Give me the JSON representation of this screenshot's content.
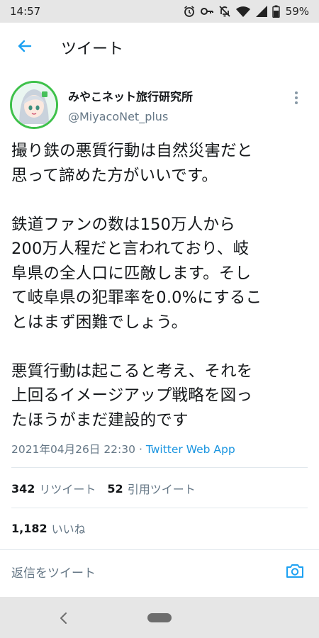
{
  "status_bar": {
    "time": "14:57",
    "battery": "59%",
    "icons": [
      "alarm-icon",
      "key-icon",
      "mute-icon",
      "wifi-icon",
      "signal-icon",
      "battery-icon"
    ]
  },
  "header": {
    "title": "ツイート",
    "back_icon": "arrow-left-icon"
  },
  "author": {
    "display_name": "みやこネット旅行研究所",
    "handle": "@MiyacoNet_plus"
  },
  "tweet": {
    "lines": [
      "撮り鉄の悪質行動は自然災害だと",
      "思って諦めた方がいいです。",
      "",
      "鉄道ファンの数は150万人から",
      "200万人程だと言われており、岐",
      "阜県の全人口に匹敵します。そし",
      "て岐阜県の犯罪率を0.0%にするこ",
      "とはまず困難でしょう。",
      "",
      "悪質行動は起こると考え、それを",
      "上回るイメージアップ戦略を図っ",
      "たほうがまだ建設的です"
    ],
    "timestamp": "2021年04月26日 22:30",
    "separator": "·",
    "source": "Twitter Web App"
  },
  "stats": {
    "retweets_count": "342",
    "retweets_label": "リツイート",
    "quotes_count": "52",
    "quotes_label": "引用ツイート",
    "likes_count": "1,182",
    "likes_label": "いいね"
  },
  "reply": {
    "placeholder": "返信をツイート"
  },
  "colors": {
    "accent": "#1da1f2",
    "avatar_border": "#3ec14a",
    "secondary_text": "#657786",
    "bars": "#e6e6e6"
  }
}
